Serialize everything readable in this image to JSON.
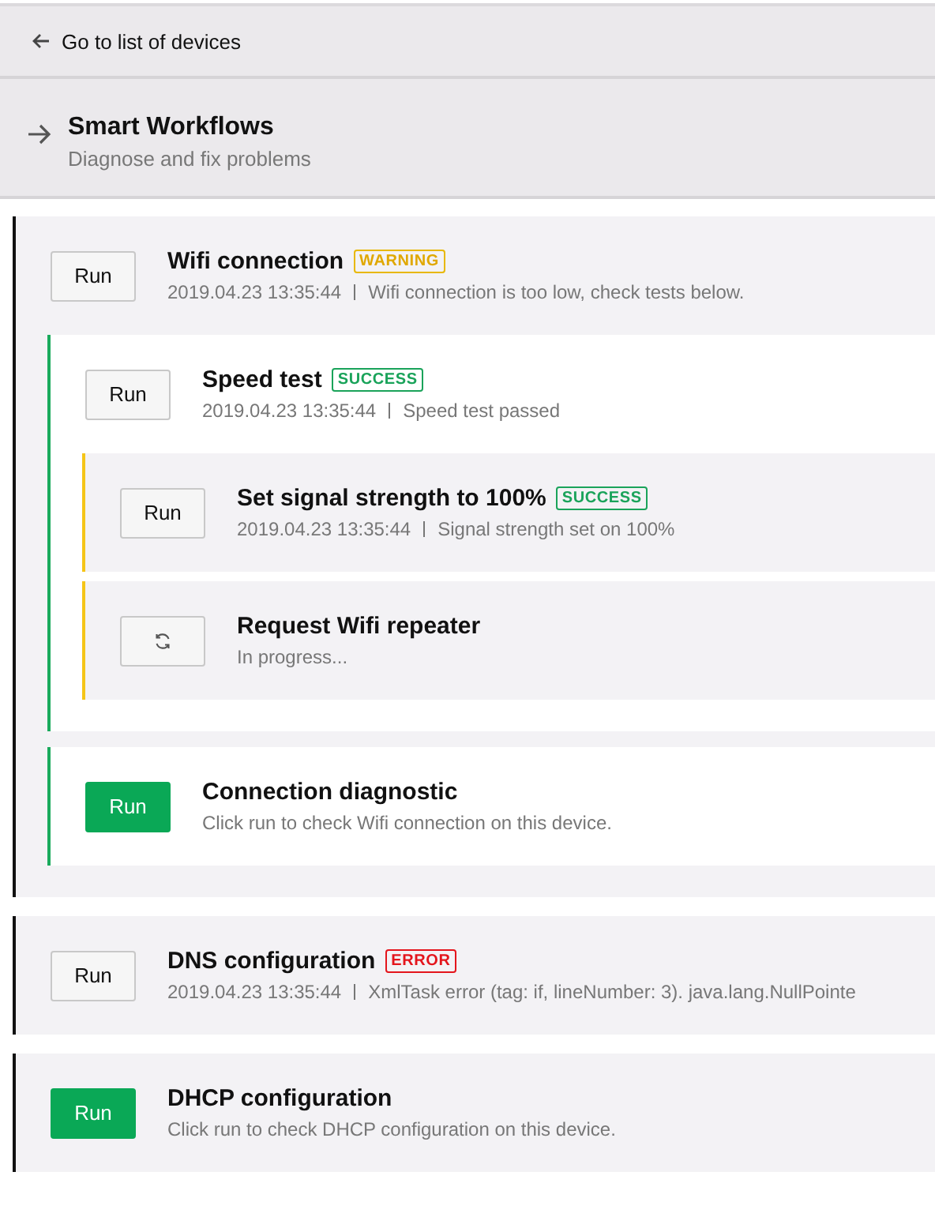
{
  "back_link": {
    "label": "Go to list of devices"
  },
  "section": {
    "title": "Smart Workflows",
    "subtitle": "Diagnose and fix problems"
  },
  "workflows": [
    {
      "title": "Wifi connection",
      "badge": {
        "kind": "warning",
        "text": "WARNING"
      },
      "color": "#111111",
      "button": {
        "kind": "outline",
        "label": "Run"
      },
      "timestamp": "2019.04.23 13:35:44",
      "message": "Wifi connection is too low, check tests below.",
      "children": [
        {
          "title": "Speed test",
          "badge": {
            "kind": "success",
            "text": "SUCCESS"
          },
          "color": "#1aaa5c",
          "button": {
            "kind": "outline",
            "label": "Run"
          },
          "timestamp": "2019.04.23 13:35:44",
          "message": "Speed test passed",
          "children": [
            {
              "title": "Set signal strength to 100%",
              "badge": {
                "kind": "success",
                "text": "SUCCESS"
              },
              "color": "#f5c518",
              "button": {
                "kind": "outline",
                "label": "Run"
              },
              "timestamp": "2019.04.23 13:35:44",
              "message": "Signal strength set on 100%"
            },
            {
              "title": "Request Wifi repeater",
              "color": "#f5c518",
              "button": {
                "kind": "loading"
              },
              "message": "In progress..."
            }
          ]
        },
        {
          "title": "Connection diagnostic",
          "color": "#1aaa5c",
          "button": {
            "kind": "primary",
            "label": "Run"
          },
          "message": "Click run to check Wifi connection on this device."
        }
      ]
    },
    {
      "title": "DNS configuration",
      "badge": {
        "kind": "error",
        "text": "ERROR"
      },
      "color": "#111111",
      "button": {
        "kind": "outline",
        "label": "Run"
      },
      "timestamp": "2019.04.23 13:35:44",
      "message": "XmlTask error (tag: if, lineNumber: 3). java.lang.NullPointe"
    },
    {
      "title": "DHCP configuration",
      "color": "#111111",
      "button": {
        "kind": "primary",
        "label": "Run"
      },
      "message": "Click run to check DHCP configuration on this device."
    }
  ]
}
